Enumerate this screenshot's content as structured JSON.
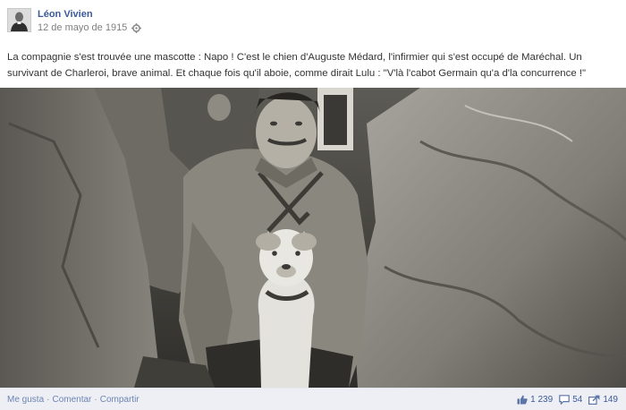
{
  "post": {
    "author": "Léon Vivien",
    "date": "12 de mayo de 1915",
    "privacy_icon": "gear-icon",
    "text": "La compagnie s'est trouvée une mascotte : Napo ! C'est le chien d'Auguste Médard, l'infirmier qui s'est occupé de Maréchal. Un survivant de Charleroi, brave animal. Et chaque fois qu'il aboie, comme dirait Lulu : \"V'là l'cabot Germain qu'a d'la concurrence !\""
  },
  "actions": {
    "like": "Me gusta",
    "comment": "Comentar",
    "share": "Compartir",
    "separator": "·"
  },
  "stats": {
    "likes": "1 239",
    "likes_icon": "thumbs-up-icon",
    "comments": "54",
    "comments_icon": "comment-icon",
    "shares": "149",
    "shares_icon": "share-icon"
  },
  "colors": {
    "link": "#3b5998",
    "action_link": "#6d84b4",
    "footer_bg": "#edeff4",
    "meta_text": "#7f7f7f"
  }
}
